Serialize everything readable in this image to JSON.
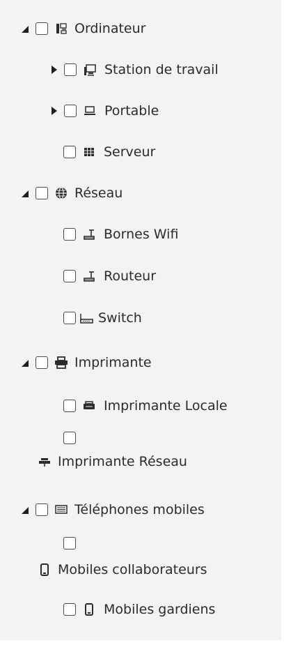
{
  "tree": {
    "ordinateur": {
      "label": "Ordinateur",
      "icon": "computer-icon",
      "expanded": true,
      "children": {
        "station_de_travail": {
          "label": "Station de travail",
          "icon": "workstation-icon",
          "expanded": false
        },
        "portable": {
          "label": "Portable",
          "icon": "laptop-icon",
          "expanded": false
        },
        "serveur": {
          "label": "Serveur",
          "icon": "server-icon"
        }
      }
    },
    "reseau": {
      "label": "Réseau",
      "icon": "globe-icon",
      "expanded": true,
      "children": {
        "bornes_wifi": {
          "label": "Bornes Wifi",
          "icon": "wifi-router-icon"
        },
        "routeur": {
          "label": "Routeur",
          "icon": "router-icon"
        },
        "switch": {
          "label": "Switch",
          "icon": "switch-icon"
        }
      }
    },
    "imprimante": {
      "label": "Imprimante",
      "icon": "printer-icon",
      "expanded": true,
      "children": {
        "imprimante_locale": {
          "label": "Imprimante Locale",
          "icon": "local-printer-icon"
        },
        "imprimante_reseau": {
          "label": "Imprimante Réseau",
          "icon": "network-printer-icon"
        }
      }
    },
    "telephones_mobiles": {
      "label": "Téléphones mobiles",
      "icon": "mobile-phones-icon",
      "expanded": true,
      "children": {
        "mobiles_collaborateurs": {
          "label": "Mobiles collaborateurs",
          "icon": "mobile-icon"
        },
        "mobiles_gardiens": {
          "label": "Mobiles gardiens",
          "icon": "mobile-icon"
        }
      }
    }
  },
  "colors": {
    "panel_background": "#f3f3f3",
    "text": "#2b2b2b",
    "icon": "#2b2b2b",
    "checkbox_border": "#4c4c4c"
  }
}
